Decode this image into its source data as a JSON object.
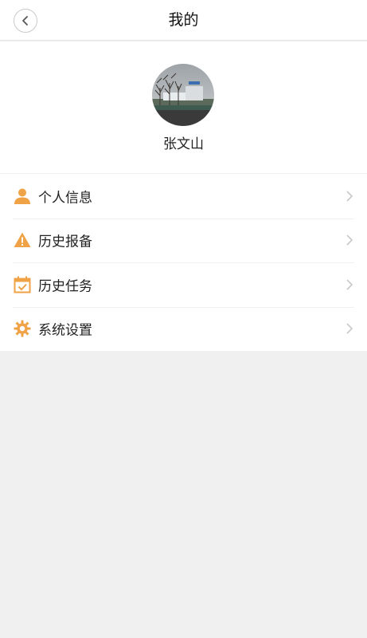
{
  "header": {
    "title": "我的",
    "back_icon": "chevron-left-icon"
  },
  "profile": {
    "name": "张文山",
    "avatar": "avatar-photo"
  },
  "menu": {
    "items": [
      {
        "label": "个人信息",
        "icon": "person-icon"
      },
      {
        "label": "历史报备",
        "icon": "warning-icon"
      },
      {
        "label": "历史任务",
        "icon": "calendar-check-icon"
      },
      {
        "label": "系统设置",
        "icon": "gear-icon"
      }
    ],
    "icon_color": "#f0a246",
    "chevron_color": "#c8c8c8"
  },
  "colors": {
    "background": "#f0f0f0",
    "surface": "#ffffff"
  }
}
